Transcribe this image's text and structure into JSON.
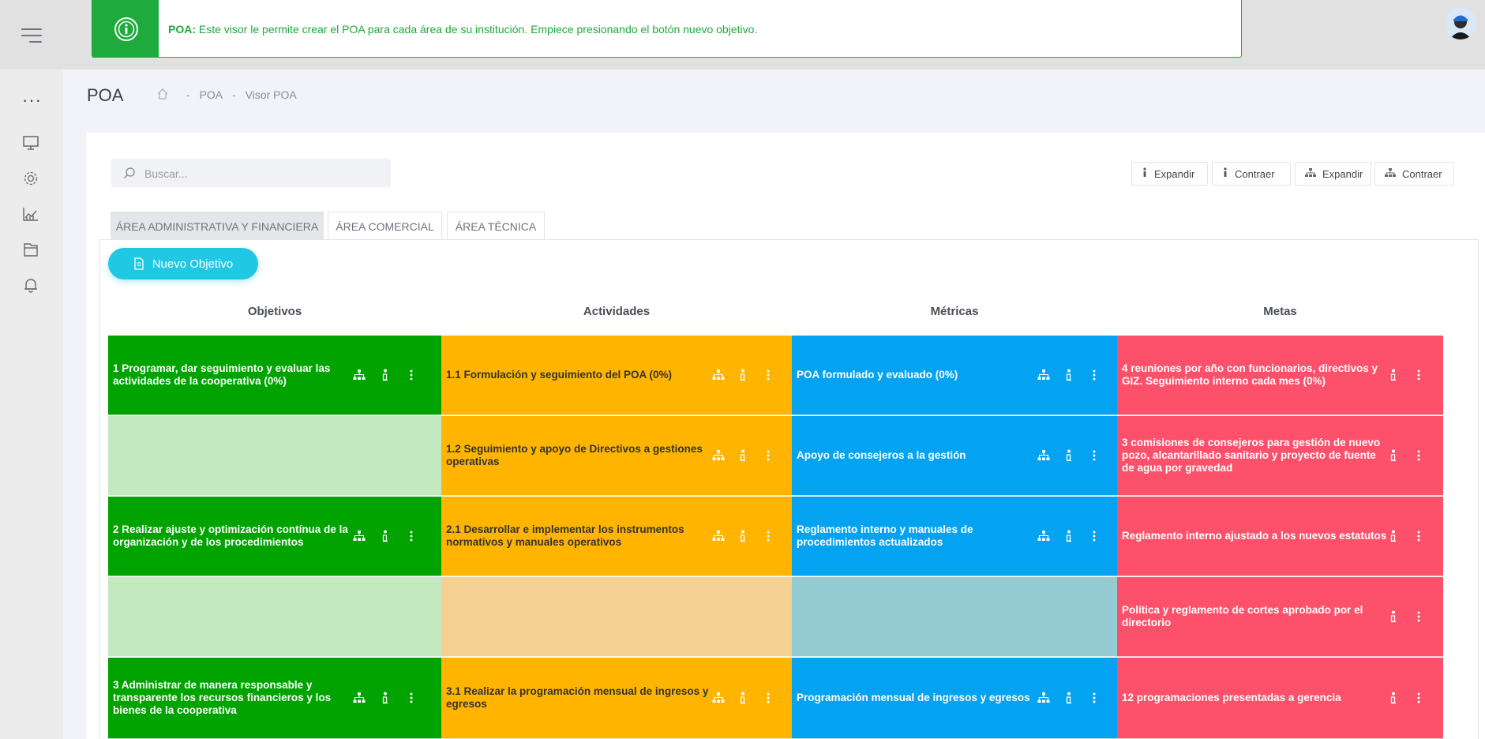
{
  "alert": {
    "label": "POA:",
    "message": "Este visor le permite crear el POA para cada área de su institución. Empiece presionando el botón nuevo objetivo."
  },
  "header": {
    "page_title": "POA"
  },
  "breadcrumb": {
    "sep1": "-",
    "item1": "POA",
    "sep2": "-",
    "item2": "Visor POA"
  },
  "search": {
    "placeholder": "Buscar..."
  },
  "toolbar": {
    "expand1": "Expandir",
    "collapse1": "Contraer",
    "expand2": "Expandir",
    "collapse2": "Contraer"
  },
  "tabs": [
    {
      "label": "ÁREA ADMINISTRATIVA Y FINANCIERA",
      "active": true
    },
    {
      "label": "ÁREA COMERCIAL",
      "active": false
    },
    {
      "label": "ÁREA TÉCNICA",
      "active": false
    }
  ],
  "new_button": {
    "label": "Nuevo Objetivo"
  },
  "columns": [
    "Objetivos",
    "Actividades",
    "Métricas",
    "Metas"
  ],
  "rows": [
    {
      "objetivo": "1 Programar, dar seguimiento y evaluar las actividades de la cooperativa (0%)",
      "actividad": "1.1 Formulación y seguimiento del POA (0%)",
      "metrica": "POA formulado y evaluado (0%)",
      "meta": "4 reuniones por año con funcionarios, directivos y GIZ. Seguimiento interno cada mes (0%)"
    },
    {
      "objetivo": "",
      "actividad": "1.2 Seguimiento y apoyo de Directivos a gestiones operativas",
      "metrica": "Apoyo de consejeros a la gestión",
      "meta": "3 comisiones de consejeros para gestión de nuevo pozo, alcantarillado sanitario y proyecto de fuente de agua por gravedad"
    },
    {
      "objetivo": "2 Realizar ajuste y optimización contínua de la organización y de los procedimientos",
      "actividad": "2.1 Desarrollar e implementar los instrumentos normativos y manuales operativos",
      "metrica": "Reglamento interno y manuales de procedimientos actualizados",
      "meta": "Reglamento interno ajustado a los nuevos estatutos"
    },
    {
      "objetivo": "",
      "actividad": "",
      "metrica": "",
      "meta": "Política y reglamento de cortes aprobado por el directorio"
    },
    {
      "objetivo": "3 Administrar de manera responsable y transparente los recursos financieros y los bienes de la cooperativa",
      "actividad": "3.1 Realizar la programación mensual de ingresos y egresos",
      "metrica": "Programación mensual de ingresos y egresos",
      "meta": "12 programaciones presentadas a gerencia"
    }
  ],
  "colors": {
    "objetivo": "#00a300",
    "objetivo_empty": "#c4e8c0",
    "actividad": "#ffb400",
    "actividad_empty": "#f4d093",
    "metrica": "#04a3f1",
    "metrica_empty": "#93cbd0",
    "meta": "#fd516b",
    "alert_green": "#1eaa3c",
    "button_cyan": "#20c8e3"
  },
  "icons": {
    "sidebar": [
      "more-icon",
      "monitor-icon",
      "gear-icon",
      "chart-icon",
      "folder-icon",
      "bell-icon"
    ],
    "row_actions": [
      "hierarchy-icon",
      "info-icon",
      "more-vertical-icon"
    ]
  }
}
